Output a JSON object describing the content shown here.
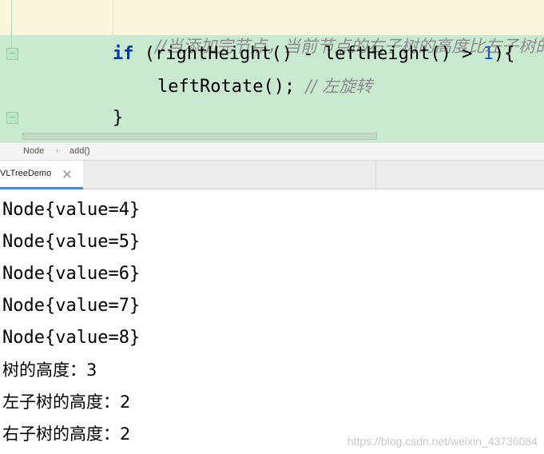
{
  "editor": {
    "comment_line": "//当添加完节点，当前节点的右子树的高度比左子树的高",
    "if_keyword": "if",
    "if_cond_start": " (rightHeight() - leftHeight() > ",
    "if_num": "1",
    "if_cond_end": "){",
    "call_stmt": "leftRotate(); ",
    "call_comment": "// 左旋转",
    "closing_brace": "}"
  },
  "breadcrumb": {
    "items": [
      "Node",
      "add()"
    ],
    "separator": "›"
  },
  "run_tab": {
    "label": "VLTreeDemo"
  },
  "console": {
    "lines": [
      "Node{value=4}",
      "Node{value=5}",
      "Node{value=6}",
      "Node{value=7}",
      "Node{value=8}",
      "树的高度：3",
      "左子树的高度：2",
      "右子树的高度：2"
    ],
    "watermark": "https://blog.csdn.net/weixin_43736084"
  },
  "colors": {
    "highlight_green": "#c9ead0",
    "current_line": "#fcf6dc",
    "keyword": "#0033b3",
    "number": "#1750eb",
    "comment": "#8c8c8c",
    "tab_accent": "#4a88c7"
  }
}
